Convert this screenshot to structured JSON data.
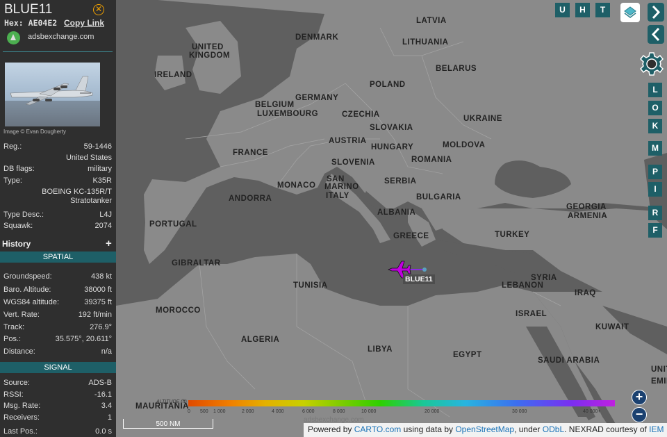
{
  "sidebar": {
    "callsign": "BLUE11",
    "hex_label": "Hex:",
    "hex_value": "AE04E2",
    "copy_link": "Copy Link",
    "source_link": "adsbexchange.com",
    "photo_credit": "Image © Evan Dougherty",
    "details": [
      {
        "label": "Reg.:",
        "value": "59-1446"
      },
      {
        "label": "",
        "value": "United States"
      },
      {
        "label": "DB flags:",
        "value": "military"
      },
      {
        "label": "Type:",
        "value": "K35R"
      },
      {
        "label": "",
        "value": "BOEING KC-135R/T"
      },
      {
        "label": "",
        "value": "Stratotanker"
      },
      {
        "label": "Type Desc.:",
        "value": "L4J"
      },
      {
        "label": "Squawk:",
        "value": "2074"
      }
    ],
    "history_label": "History",
    "history_toggle": "+",
    "spatial_header": "SPATIAL",
    "spatial": [
      {
        "label": "Groundspeed:",
        "value": "438 kt"
      },
      {
        "label": "Baro. Altitude:",
        "value": "38000 ft"
      },
      {
        "label": "WGS84 altitude:",
        "value": "39375 ft"
      },
      {
        "label": "Vert. Rate:",
        "value": "192 ft/min"
      },
      {
        "label": "Track:",
        "value": "276.9°"
      },
      {
        "label": "Pos.:",
        "value": "35.575°, 20.611°"
      },
      {
        "label": "Distance:",
        "value": "n/a"
      }
    ],
    "signal_header": "SIGNAL",
    "signal": [
      {
        "label": "Source:",
        "value": "ADS-B"
      },
      {
        "label": "RSSI:",
        "value": "-16.1"
      },
      {
        "label": "Msg. Rate:",
        "value": "3.4"
      },
      {
        "label": "Receivers:",
        "value": "1"
      },
      {
        "label": "Last Pos.:",
        "value": "0.0 s"
      }
    ]
  },
  "map": {
    "labels": [
      "LATVIA",
      "DENMARK",
      "LITHUANIA",
      "UNITED",
      "KINGDOM",
      "IRELAND",
      "BELARUS",
      "POLAND",
      "GERMANY",
      "BELGIUM",
      "LUXEMBOURG",
      "CZECHIA",
      "UKRAINE",
      "SLOVAKIA",
      "AUSTRIA",
      "HUNGARY",
      "MOLDOVA",
      "FRANCE",
      "SLOVENIA",
      "ROMANIA",
      "SAN",
      "MARINO",
      "MONACO",
      "SERBIA",
      "ANDORRA",
      "ITALY",
      "BULGARIA",
      "GEORGIA",
      "ARMENIA",
      "ALBANIA",
      "PORTUGAL",
      "GREECE",
      "TURKEY",
      "GIBRALTAR",
      "SYRIA",
      "TUNISIA",
      "LEBANON",
      "IRAQ",
      "MOROCCO",
      "ISRAEL",
      "KUWAIT",
      "ALGERIA",
      "LIBYA",
      "EGYPT",
      "SAUDI ARABIA",
      "UNITED",
      "EMIRA",
      "MAURITANIA"
    ],
    "aircraft_label": "BLUE11",
    "buttons": {
      "u": "U",
      "h": "H",
      "t": "T",
      "side": [
        "L",
        "O",
        "K",
        "M",
        "P",
        "I",
        "R",
        "F"
      ],
      "zoom_in": "+",
      "zoom_out": "−"
    },
    "scale_label": "500 NM",
    "altitude_title": "ALTITUDE (ft)",
    "altitude_ticks": [
      "0",
      "500",
      "1 000",
      "2 000",
      "4 000",
      "6 000",
      "8 000",
      "10 000",
      "20 000",
      "30 000",
      "40 000+"
    ],
    "watermark": "adsbexchange.com",
    "attribution": {
      "t1": "Powered by ",
      "carto": "CARTO.com",
      "t2": " using data by ",
      "osm": "OpenStreetMap",
      "t3": ", under ",
      "odbl": "ODbL",
      "t4": ". NEXRAD courtesy of ",
      "iem": "IEM"
    },
    "colors": {
      "land": "#8c8c8c",
      "sea": "#5f5f5f",
      "accent": "#1e5f67",
      "aircraft": "#c000e0"
    }
  }
}
